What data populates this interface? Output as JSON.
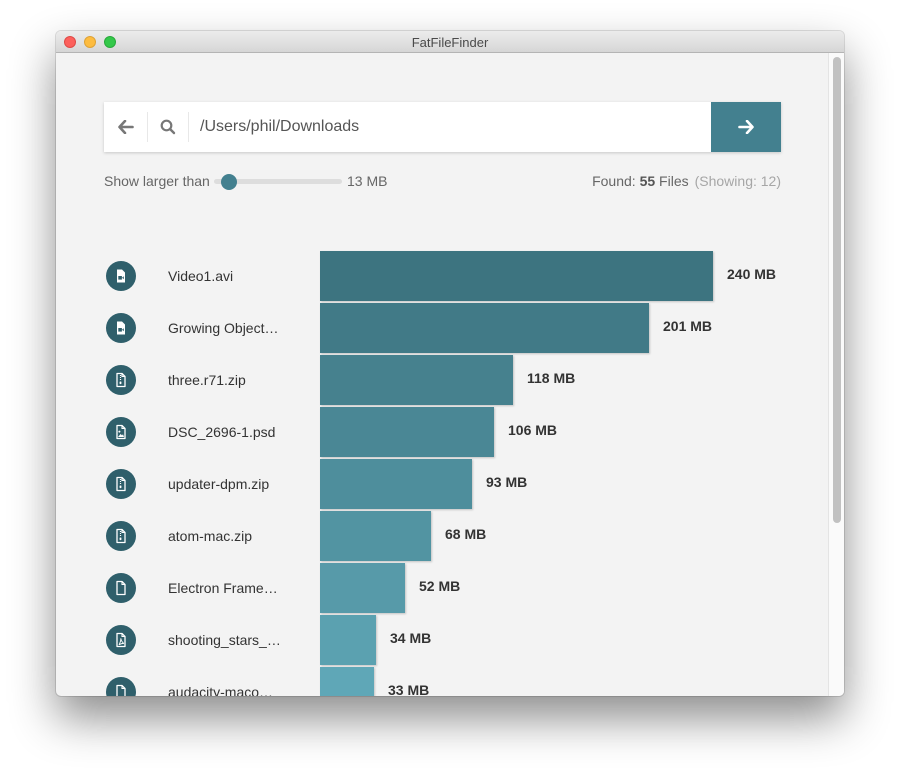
{
  "window": {
    "title": "FatFileFinder"
  },
  "search": {
    "back_icon": "arrow-left-icon",
    "search_icon": "search-icon",
    "path_value": "/Users/phil/Downloads",
    "go_icon": "arrow-right-icon"
  },
  "filter": {
    "label": "Show larger than",
    "slider_fraction": 0.12,
    "value_text": "13 MB"
  },
  "summary": {
    "found_prefix": "Found:",
    "found_count": "55",
    "found_suffix": "Files",
    "showing_text": "(Showing: 12)"
  },
  "colors": {
    "accent": "#43808f",
    "icon_bg": "#2f5f6b",
    "bar_dark": "#3d7480",
    "bar_light": "#5fa7b7"
  },
  "files": [
    {
      "name": "Video1.avi",
      "size_mb": 240,
      "size_label": "240 MB",
      "icon": "file-video-icon"
    },
    {
      "name": "Growing Object…",
      "size_mb": 201,
      "size_label": "201 MB",
      "icon": "file-video-icon"
    },
    {
      "name": "three.r71.zip",
      "size_mb": 118,
      "size_label": "118 MB",
      "icon": "file-zip-icon"
    },
    {
      "name": "DSC_2696-1.psd",
      "size_mb": 106,
      "size_label": "106 MB",
      "icon": "file-image-icon"
    },
    {
      "name": "updater-dpm.zip",
      "size_mb": 93,
      "size_label": "93 MB",
      "icon": "file-zip-icon"
    },
    {
      "name": "atom-mac.zip",
      "size_mb": 68,
      "size_label": "68 MB",
      "icon": "file-zip-icon"
    },
    {
      "name": "Electron Frame…",
      "size_mb": 52,
      "size_label": "52 MB",
      "icon": "file-icon"
    },
    {
      "name": "shooting_stars_…",
      "size_mb": 34,
      "size_label": "34 MB",
      "icon": "file-pdf-icon"
    },
    {
      "name": "audacity-maco…",
      "size_mb": 33,
      "size_label": "33 MB",
      "icon": "file-icon"
    }
  ],
  "chart_data": {
    "type": "bar",
    "orientation": "horizontal",
    "categories": [
      "Video1.avi",
      "Growing Object…",
      "three.r71.zip",
      "DSC_2696-1.psd",
      "updater-dpm.zip",
      "atom-mac.zip",
      "Electron Frame…",
      "shooting_stars_…",
      "audacity-maco…"
    ],
    "values": [
      240,
      201,
      118,
      106,
      93,
      68,
      52,
      34,
      33
    ],
    "unit": "MB",
    "title": "",
    "xlabel": "",
    "ylabel": "",
    "xlim": [
      0,
      240
    ],
    "grid": false,
    "legend": "none"
  }
}
